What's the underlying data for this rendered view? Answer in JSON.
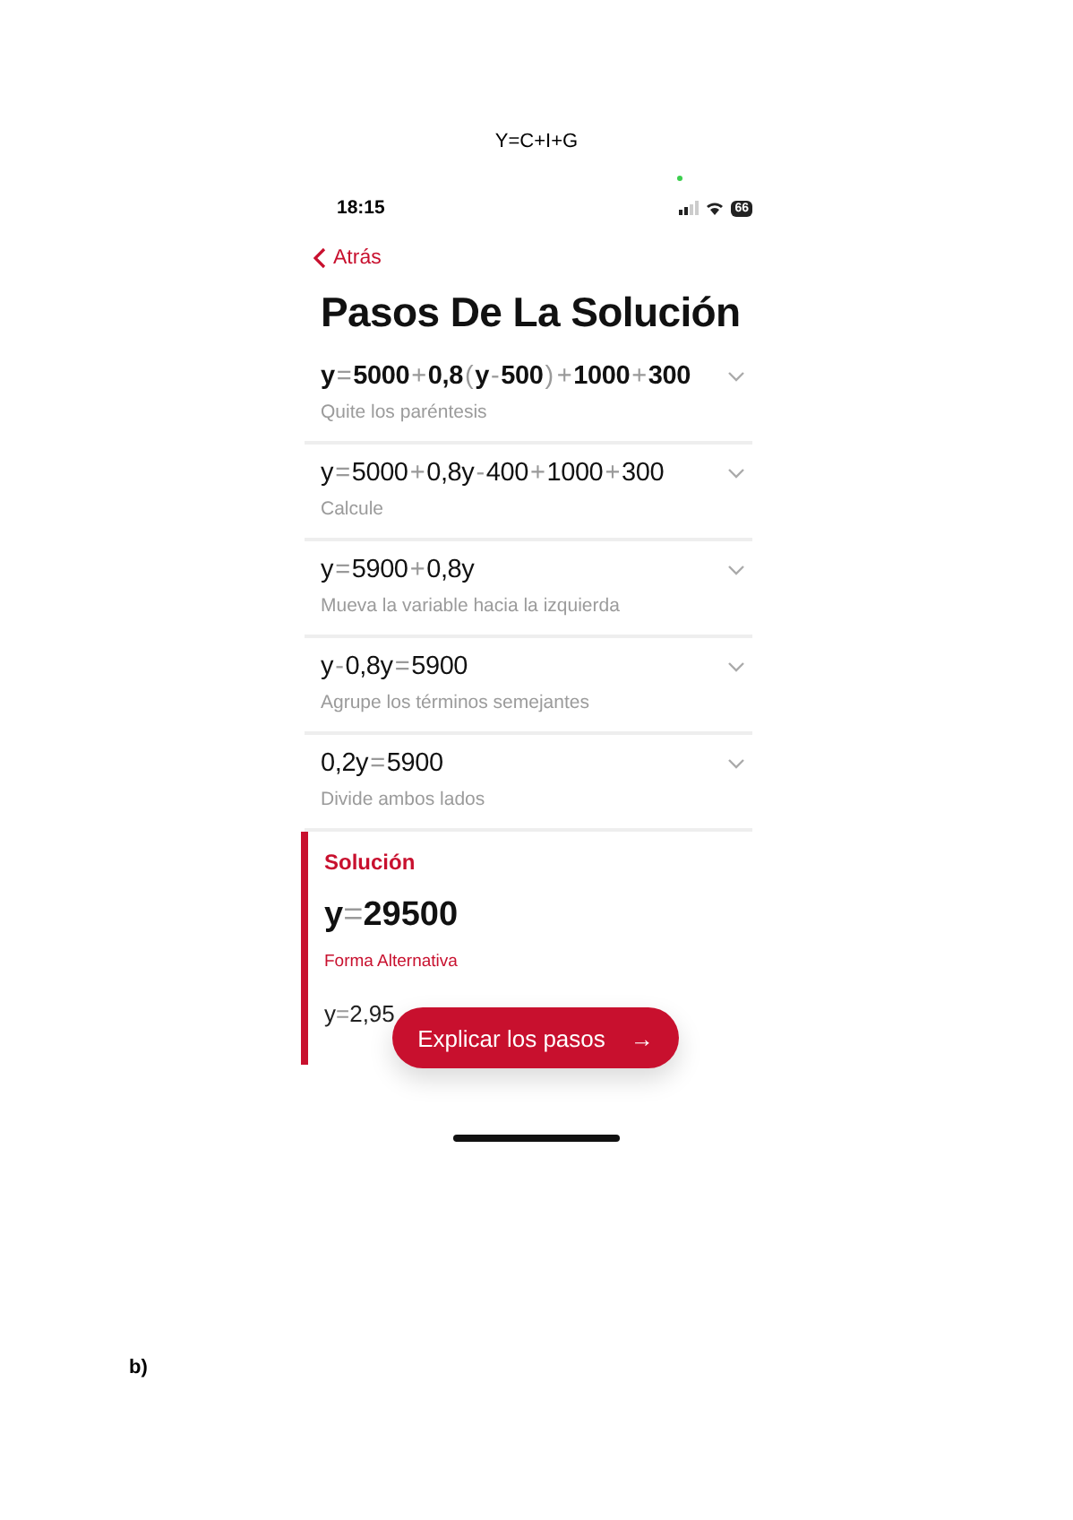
{
  "document": {
    "title": "Y=C+I+G",
    "footer_label": "b)"
  },
  "status_bar": {
    "time": "18:15",
    "battery": "66"
  },
  "nav": {
    "back": "Atrás"
  },
  "heading": "Pasos De La Solución",
  "steps": [
    {
      "equation": "y=5000+0,8(y-500)+1000+300",
      "hint": "Quite los paréntesis",
      "highlighted": true
    },
    {
      "equation": "y=5000+0,8y-400+1000+300",
      "hint": "Calcule",
      "highlighted": false
    },
    {
      "equation": "y=5900+0,8y",
      "hint": "Mueva la variable hacia la izquierda",
      "highlighted": false
    },
    {
      "equation": "y-0,8y=5900",
      "hint": "Agrupe los términos semejantes",
      "highlighted": false
    },
    {
      "equation": "0,2y=5900",
      "hint": "Divide ambos lados",
      "highlighted": false
    }
  ],
  "solution": {
    "label": "Solución",
    "result": "y=29500",
    "alternative_label": "Forma Alternativa",
    "alternative": "y=2,95"
  },
  "explain_button": {
    "label": "Explicar los pasos",
    "icon": "→"
  }
}
